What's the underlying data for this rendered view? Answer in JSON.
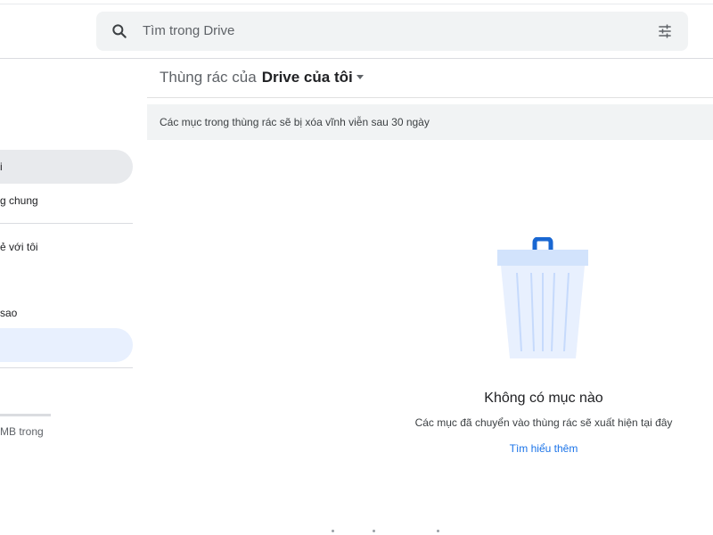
{
  "search": {
    "placeholder": "Tìm trong Drive"
  },
  "sidebar": {
    "items": [
      {
        "label": "i",
        "state": "selected"
      },
      {
        "label": "g chung",
        "state": "normal"
      },
      {
        "label": "ẻ với tôi",
        "state": "normal"
      },
      {
        "label": "sao",
        "state": "normal"
      },
      {
        "label": "",
        "state": "active"
      }
    ],
    "storage": {
      "text": "MB trong"
    }
  },
  "main": {
    "breadcrumb_prefix": "Thùng rác của",
    "breadcrumb_drive": "Drive của tôi",
    "notice": "Các mục trong thùng rác sẽ bị xóa vĩnh viễn sau 30 ngày",
    "empty_title": "Không có mục nào",
    "empty_subtitle": "Các mục đã chuyển vào thùng rác sẽ xuất hiện tại đây",
    "learn_more": "Tìm hiểu thêm"
  },
  "colors": {
    "accent": "#1a73e8",
    "nav_selected_bg": "#e8eaed",
    "nav_active_bg": "#e8f0fe",
    "trash_light": "#e8f0fe",
    "trash_lid": "#d2e3fc",
    "trash_handle": "#1967d2"
  },
  "icons": [
    "search-icon",
    "tune-icon",
    "dropdown-caret-icon",
    "trash-can-icon"
  ]
}
